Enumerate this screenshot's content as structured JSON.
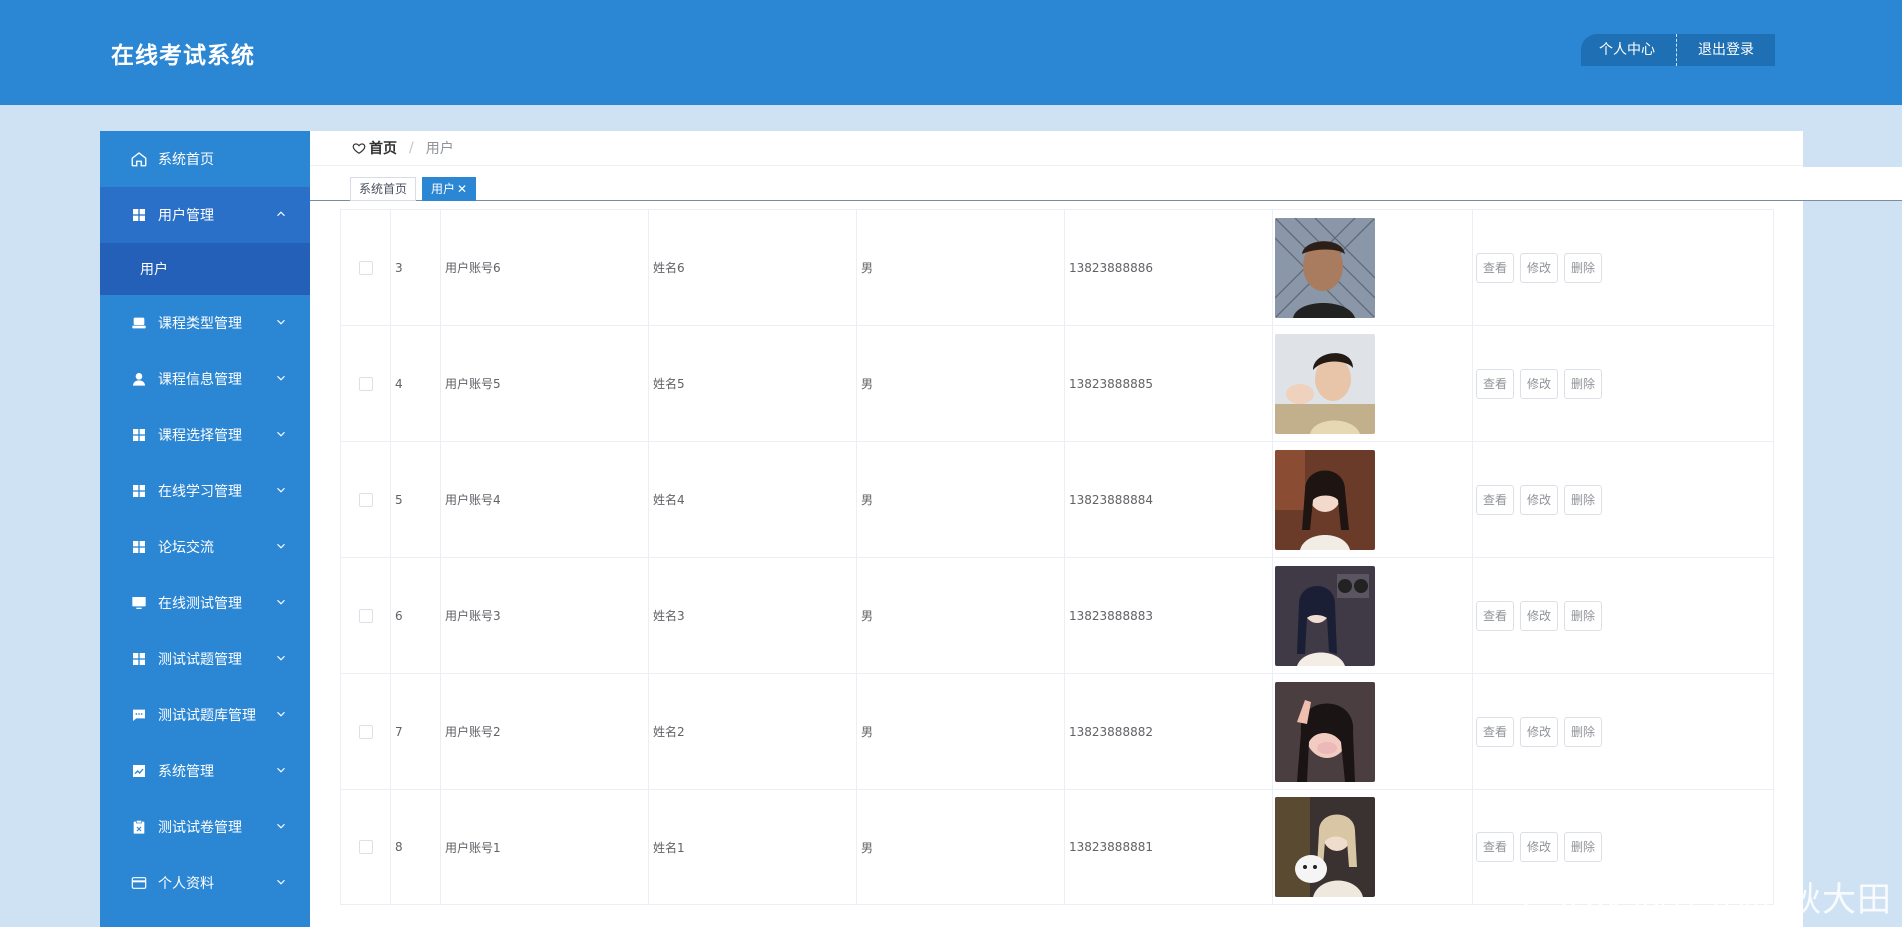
{
  "app": {
    "title": "在线考试系统"
  },
  "topbar": {
    "profile_label": "个人中心",
    "logout_label": "退出登录"
  },
  "sidebar": {
    "items": [
      {
        "label": "系统首页",
        "icon": "home-icon"
      },
      {
        "label": "用户管理",
        "icon": "grid-icon",
        "open": true,
        "sub": [
          "用户"
        ]
      },
      {
        "label": "课程类型管理",
        "icon": "tray-icon"
      },
      {
        "label": "课程信息管理",
        "icon": "user-icon"
      },
      {
        "label": "课程选择管理",
        "icon": "grid-icon"
      },
      {
        "label": "在线学习管理",
        "icon": "grid-icon"
      },
      {
        "label": "论坛交流",
        "icon": "grid-icon"
      },
      {
        "label": "在线测试管理",
        "icon": "monitor-icon"
      },
      {
        "label": "测试试题管理",
        "icon": "grid-icon"
      },
      {
        "label": "测试试题库管理",
        "icon": "chat-icon"
      },
      {
        "label": "系统管理",
        "icon": "chart-icon"
      },
      {
        "label": "测试试卷管理",
        "icon": "clipboard-icon"
      },
      {
        "label": "个人资料",
        "icon": "card-icon"
      }
    ]
  },
  "breadcrumb": {
    "home": "首页",
    "separator": "/",
    "current": "用户"
  },
  "tags": {
    "home": "系统首页",
    "current": "用户",
    "close": "✕"
  },
  "table": {
    "actions": {
      "view": "查看",
      "edit": "修改",
      "delete": "删除"
    },
    "rows": [
      {
        "index": "3",
        "account": "用户账号6",
        "name": "姓名6",
        "gender": "男",
        "phone": "13823888886",
        "photo": "man-short-hair"
      },
      {
        "index": "4",
        "account": "用户账号5",
        "name": "姓名5",
        "gender": "男",
        "phone": "13823888885",
        "photo": "young-man"
      },
      {
        "index": "5",
        "account": "用户账号4",
        "name": "姓名4",
        "gender": "男",
        "phone": "13823888884",
        "photo": "girl-braids"
      },
      {
        "index": "6",
        "account": "用户账号3",
        "name": "姓名3",
        "gender": "男",
        "phone": "13823888883",
        "photo": "girl-dark-hair"
      },
      {
        "index": "7",
        "account": "用户账号2",
        "name": "姓名2",
        "gender": "男",
        "phone": "13823888882",
        "photo": "girl-peace-sign"
      },
      {
        "index": "8",
        "account": "用户账号1",
        "name": "姓名1",
        "gender": "男",
        "phone": "13823888881",
        "photo": "girl-with-dog"
      }
    ]
  },
  "watermark": "CSDN @计算机-秋大田",
  "colors": {
    "header": "#2b86d3",
    "sidebar": "#2b86d3",
    "submenu": "#2560b8",
    "page_bg": "#cfe2f3"
  }
}
